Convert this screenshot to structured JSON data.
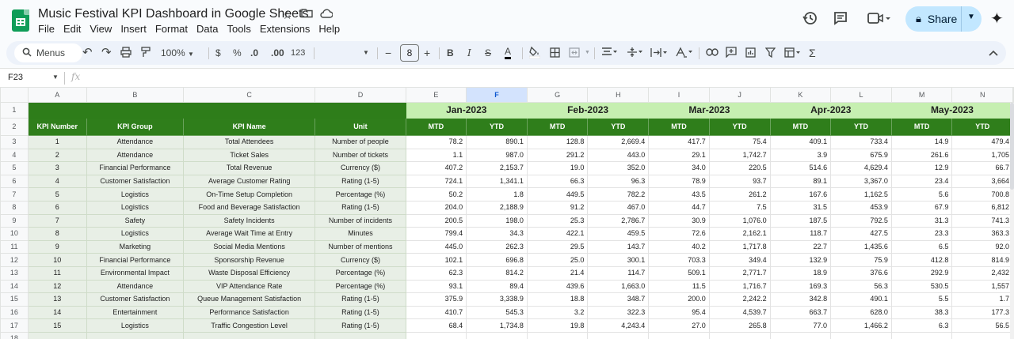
{
  "app": {
    "doc_title": "Music Festival KPI Dashboard in Google Sheets",
    "menu": [
      "File",
      "Edit",
      "View",
      "Insert",
      "Format",
      "Data",
      "Tools",
      "Extensions",
      "Help"
    ],
    "share_label": "Share"
  },
  "toolbar": {
    "menus_label": "Menus",
    "zoom": "100%",
    "currency": "$",
    "percent": "%",
    "dec_decrease": ".0",
    "dec_increase": ".00",
    "number_format": "123",
    "font_size": "8",
    "bold": "B",
    "italic": "I",
    "text_color": "A",
    "sigma": "Σ"
  },
  "formula_bar": {
    "cell_ref": "F23",
    "fx": "fx"
  },
  "sheet": {
    "columns": [
      "A",
      "B",
      "C",
      "D",
      "E",
      "F",
      "G",
      "H",
      "I",
      "J",
      "K",
      "L",
      "M",
      "N"
    ],
    "selected_column": "F",
    "months": [
      "Jan-2023",
      "Feb-2023",
      "Mar-2023",
      "Apr-2023",
      "May-2023"
    ],
    "header": {
      "kpi_number": "KPI Number",
      "kpi_group": "KPI Group",
      "kpi_name": "KPI Name",
      "unit": "Unit",
      "mtd": "MTD",
      "ytd": "YTD"
    },
    "rows": [
      {
        "num": "1",
        "group": "Attendance",
        "name": "Total Attendees",
        "unit": "Number of people",
        "vals": [
          "78.2",
          "890.1",
          "128.8",
          "2,669.4",
          "417.7",
          "75.4",
          "409.1",
          "733.4",
          "14.9",
          "479.4"
        ]
      },
      {
        "num": "2",
        "group": "Attendance",
        "name": "Ticket Sales",
        "unit": "Number of tickets",
        "vals": [
          "1.1",
          "987.0",
          "291.2",
          "443.0",
          "29.1",
          "1,742.7",
          "3.9",
          "675.9",
          "261.6",
          "1,705"
        ]
      },
      {
        "num": "3",
        "group": "Financial Performance",
        "name": "Total Revenue",
        "unit": "Currency ($)",
        "vals": [
          "407.2",
          "2,153.7",
          "19.0",
          "352.0",
          "34.0",
          "220.5",
          "514.6",
          "4,629.4",
          "12.9",
          "66.7"
        ]
      },
      {
        "num": "4",
        "group": "Customer Satisfaction",
        "name": "Average Customer Rating",
        "unit": "Rating (1-5)",
        "vals": [
          "724.1",
          "1,341.1",
          "66.3",
          "96.3",
          "78.9",
          "93.7",
          "89.1",
          "3,367.0",
          "23.4",
          "3,664"
        ]
      },
      {
        "num": "5",
        "group": "Logistics",
        "name": "On-Time Setup Completion",
        "unit": "Percentage (%)",
        "vals": [
          "50.2",
          "1.8",
          "449.5",
          "782.2",
          "43.5",
          "261.2",
          "167.6",
          "1,162.5",
          "5.6",
          "700.8"
        ]
      },
      {
        "num": "6",
        "group": "Logistics",
        "name": "Food and Beverage Satisfaction",
        "unit": "Rating (1-5)",
        "vals": [
          "204.0",
          "2,188.9",
          "91.2",
          "467.0",
          "44.7",
          "7.5",
          "31.5",
          "453.9",
          "67.9",
          "6,812"
        ]
      },
      {
        "num": "7",
        "group": "Safety",
        "name": "Safety Incidents",
        "unit": "Number of incidents",
        "vals": [
          "200.5",
          "198.0",
          "25.3",
          "2,786.7",
          "30.9",
          "1,076.0",
          "187.5",
          "792.5",
          "31.3",
          "741.3"
        ]
      },
      {
        "num": "8",
        "group": "Logistics",
        "name": "Average Wait Time at Entry",
        "unit": "Minutes",
        "vals": [
          "799.4",
          "34.3",
          "422.1",
          "459.5",
          "72.6",
          "2,162.1",
          "118.7",
          "427.5",
          "23.3",
          "363.3"
        ]
      },
      {
        "num": "9",
        "group": "Marketing",
        "name": "Social Media Mentions",
        "unit": "Number of mentions",
        "vals": [
          "445.0",
          "262.3",
          "29.5",
          "143.7",
          "40.2",
          "1,717.8",
          "22.7",
          "1,435.6",
          "6.5",
          "92.0"
        ]
      },
      {
        "num": "10",
        "group": "Financial Performance",
        "name": "Sponsorship Revenue",
        "unit": "Currency ($)",
        "vals": [
          "102.1",
          "696.8",
          "25.0",
          "300.1",
          "703.3",
          "349.4",
          "132.9",
          "75.9",
          "412.8",
          "814.9"
        ]
      },
      {
        "num": "11",
        "group": "Environmental Impact",
        "name": "Waste Disposal Efficiency",
        "unit": "Percentage (%)",
        "vals": [
          "62.3",
          "814.2",
          "21.4",
          "114.7",
          "509.1",
          "2,771.7",
          "18.9",
          "376.6",
          "292.9",
          "2,432"
        ]
      },
      {
        "num": "12",
        "group": "Attendance",
        "name": "VIP Attendance Rate",
        "unit": "Percentage (%)",
        "vals": [
          "93.1",
          "89.4",
          "439.6",
          "1,663.0",
          "11.5",
          "1,716.7",
          "169.3",
          "56.3",
          "530.5",
          "1,557"
        ]
      },
      {
        "num": "13",
        "group": "Customer Satisfaction",
        "name": "Queue Management Satisfaction",
        "unit": "Rating (1-5)",
        "vals": [
          "375.9",
          "3,338.9",
          "18.8",
          "348.7",
          "200.0",
          "2,242.2",
          "342.8",
          "490.1",
          "5.5",
          "1.7"
        ]
      },
      {
        "num": "14",
        "group": "Entertainment",
        "name": "Performance Satisfaction",
        "unit": "Rating (1-5)",
        "vals": [
          "410.7",
          "545.3",
          "3.2",
          "322.3",
          "95.4",
          "4,539.7",
          "663.7",
          "628.0",
          "38.3",
          "177.3"
        ]
      },
      {
        "num": "15",
        "group": "Logistics",
        "name": "Traffic Congestion Level",
        "unit": "Rating (1-5)",
        "vals": [
          "68.4",
          "1,734.8",
          "19.8",
          "4,243.4",
          "27.0",
          "265.8",
          "77.0",
          "1,466.2",
          "6.3",
          "56.5"
        ]
      }
    ]
  }
}
